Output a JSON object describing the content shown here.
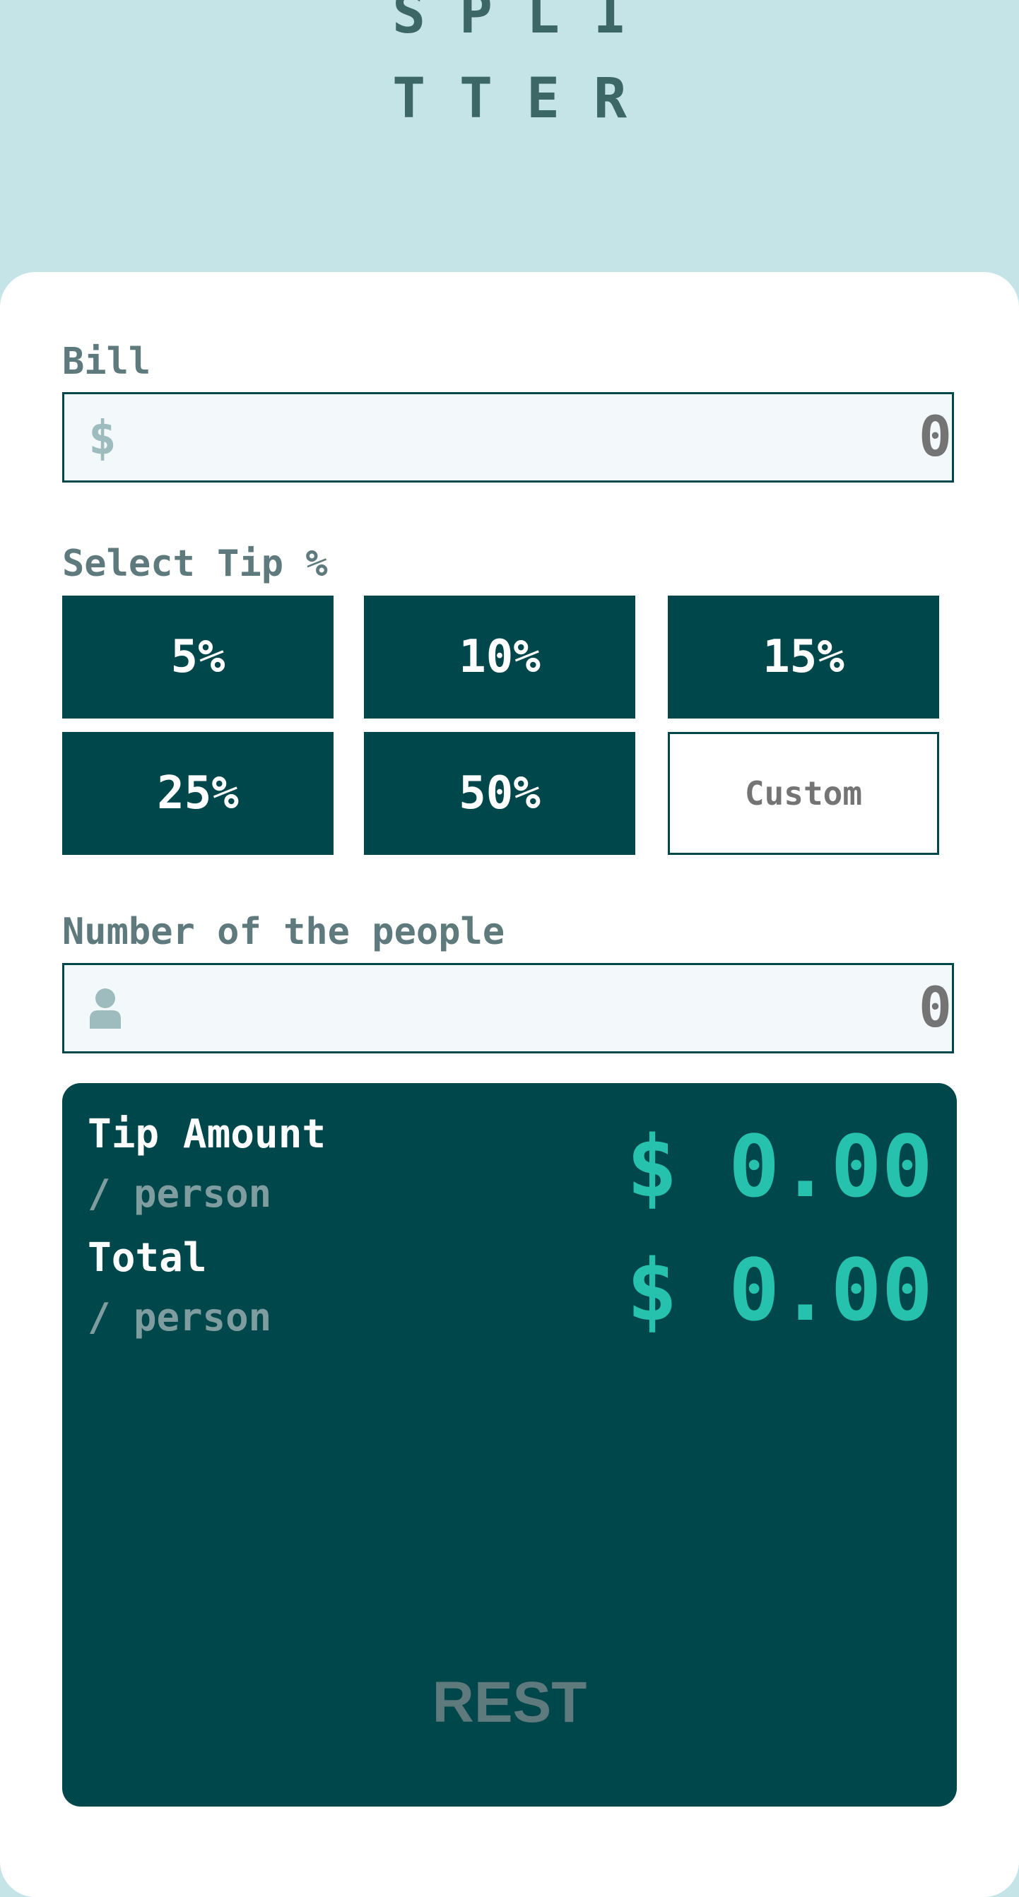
{
  "app": {
    "logo_line1": "SPLI",
    "logo_line2": "TTER"
  },
  "bill": {
    "label": "Bill",
    "icon": "dollar-icon",
    "icon_glyph": "$",
    "value": "0"
  },
  "tip": {
    "label": "Select Tip %",
    "options": [
      "5%",
      "10%",
      "15%",
      "25%",
      "50%"
    ],
    "custom_label": "Custom"
  },
  "people": {
    "label": "Number of the people",
    "icon": "person-icon",
    "value": "0"
  },
  "results": {
    "tip_label": "Tip Amount",
    "tip_sub": "/ person",
    "tip_value": "$ 0.00",
    "total_label": "Total",
    "total_sub": "/ person",
    "total_value": "$ 0.00",
    "reset_label": "REST"
  },
  "colors": {
    "background": "#c5e4e7",
    "dark_cyan": "#00474b",
    "strong_cyan": "#26c2ae",
    "grayish_cyan": "#5e7a7d",
    "input_bg": "#f3f9fa"
  }
}
